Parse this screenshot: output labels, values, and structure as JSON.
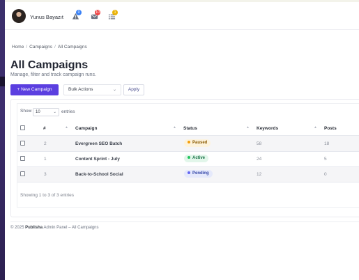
{
  "topbar": {
    "username": "Yunus Bayazıt",
    "icons": [
      {
        "name": "alert-triangle-icon",
        "badge": "0",
        "badge_color": "#3b82f6"
      },
      {
        "name": "mail-icon",
        "badge": "10",
        "badge_color": "#ef4444"
      },
      {
        "name": "list-icon",
        "badge": "1",
        "badge_color": "#eab308"
      }
    ]
  },
  "breadcrumb": {
    "home": "Home",
    "campaigns": "Campaigns",
    "current": "All Campaigns"
  },
  "page": {
    "title": "All Campaigns",
    "subtitle": "Manage, filter and track campaign runs."
  },
  "toolbar": {
    "new_label": "+  New Campaign",
    "bulk_label": "Bulk Actions",
    "apply_label": "Apply"
  },
  "table": {
    "show_label": "Show",
    "length_value": "10",
    "entries_label": "entries",
    "columns": [
      "#",
      "Campaign",
      "Status",
      "Keywords",
      "Posts"
    ],
    "rows": [
      {
        "id": "2",
        "campaign": "Evergreen SEO Batch",
        "status": "Paused",
        "keywords": "58",
        "posts": "18"
      },
      {
        "id": "1",
        "campaign": "Content Sprint - July",
        "status": "Active",
        "keywords": "24",
        "posts": "5"
      },
      {
        "id": "3",
        "campaign": "Back-to-School Social",
        "status": "Pending",
        "keywords": "12",
        "posts": "0"
      }
    ],
    "showing": "Showing 1 to 3 of 3 entries"
  },
  "status_colors": {
    "Paused": {
      "bg": "#fdf3dc",
      "fg": "#8a5a00",
      "dot": "#f59e0b"
    },
    "Active": {
      "bg": "#e2f6ea",
      "fg": "#177245",
      "dot": "#22c55e"
    },
    "Pending": {
      "bg": "#e5e9fb",
      "fg": "#3346a8",
      "dot": "#6366f1"
    }
  },
  "footer": {
    "prefix": "© 2025 ",
    "brand": "Publisha",
    "suffix": " Admin Panel – All Campaigns"
  },
  "colors": {
    "accent": "#5b3fe0",
    "sidebar": "#3b2f6b"
  }
}
